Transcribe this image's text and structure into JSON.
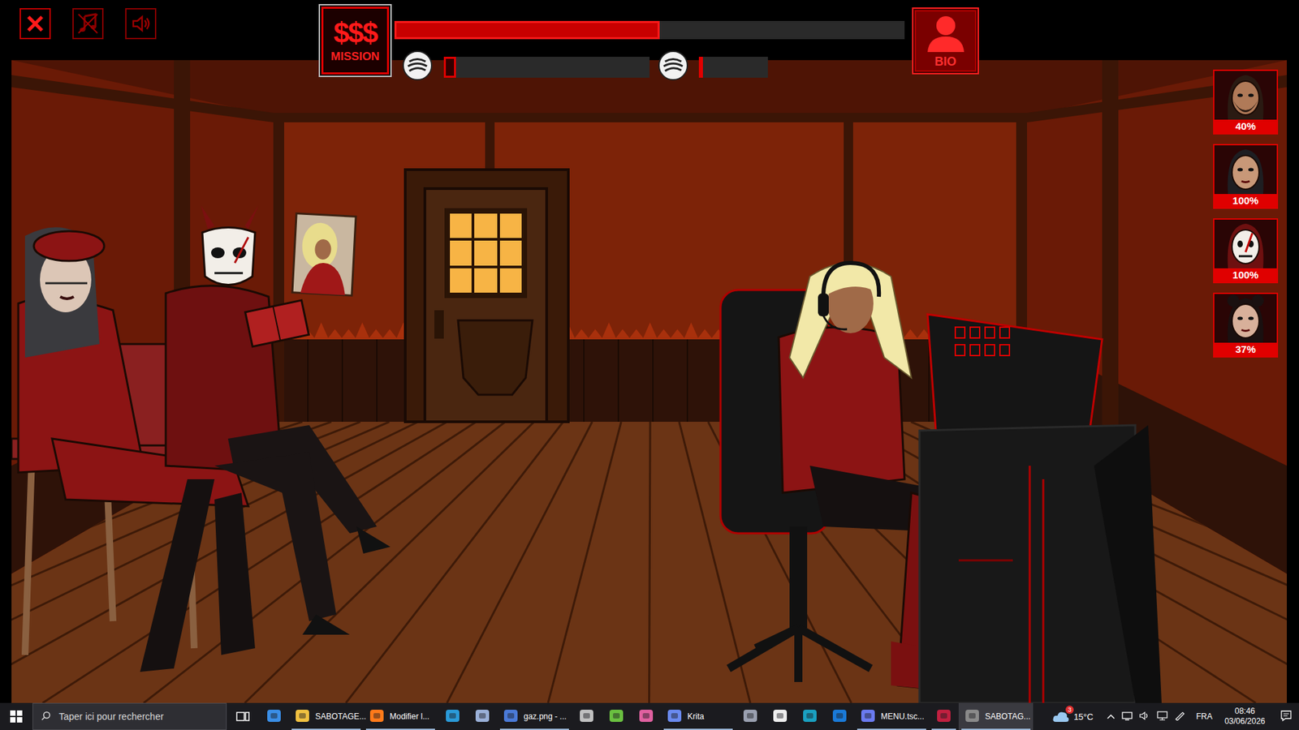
{
  "controls": {
    "music_muted": true,
    "sound_muted": false
  },
  "mission": {
    "symbol": "$$$",
    "label": "MISSION"
  },
  "progress": {
    "level": 0.52
  },
  "resources": [
    {
      "level": 0.06
    },
    {
      "level": 0
    }
  ],
  "bio": {
    "label": "BIO"
  },
  "team": [
    {
      "percent": "40%"
    },
    {
      "percent": "100%"
    },
    {
      "percent": "100%"
    },
    {
      "percent": "37%"
    }
  ],
  "taskbar": {
    "search": {
      "placeholder": "Taper ici pour rechercher"
    },
    "items": [
      {
        "kind": "icon",
        "running": false,
        "selected": false
      },
      {
        "kind": "app",
        "label": "SABOTAGE...",
        "running": true,
        "selected": false
      },
      {
        "kind": "app",
        "label": "Modifier l...",
        "running": true,
        "selected": false
      },
      {
        "kind": "icon",
        "running": false,
        "selected": false
      },
      {
        "kind": "icon",
        "running": false,
        "selected": false
      },
      {
        "kind": "app",
        "label": "gaz.png - ...",
        "running": true,
        "selected": false
      },
      {
        "kind": "icon",
        "running": false,
        "selected": false
      },
      {
        "kind": "icon",
        "running": false,
        "selected": false
      },
      {
        "kind": "icon",
        "running": false,
        "selected": false
      },
      {
        "kind": "app",
        "label": "Krita",
        "running": true,
        "selected": false
      },
      {
        "kind": "icon",
        "running": false,
        "selected": false
      },
      {
        "kind": "icon",
        "running": false,
        "selected": false
      },
      {
        "kind": "icon",
        "running": false,
        "selected": false
      },
      {
        "kind": "icon",
        "running": false,
        "selected": false
      },
      {
        "kind": "app",
        "label": "MENU.tsc...",
        "running": true,
        "selected": false
      },
      {
        "kind": "icon",
        "running": true,
        "selected": false
      },
      {
        "kind": "app",
        "label": "SABOTAG...",
        "running": true,
        "selected": true
      }
    ],
    "weather": {
      "temp": "15°C",
      "badge": "3"
    },
    "language": "FRA",
    "time": "08:46",
    "date": "03/06/2026"
  }
}
